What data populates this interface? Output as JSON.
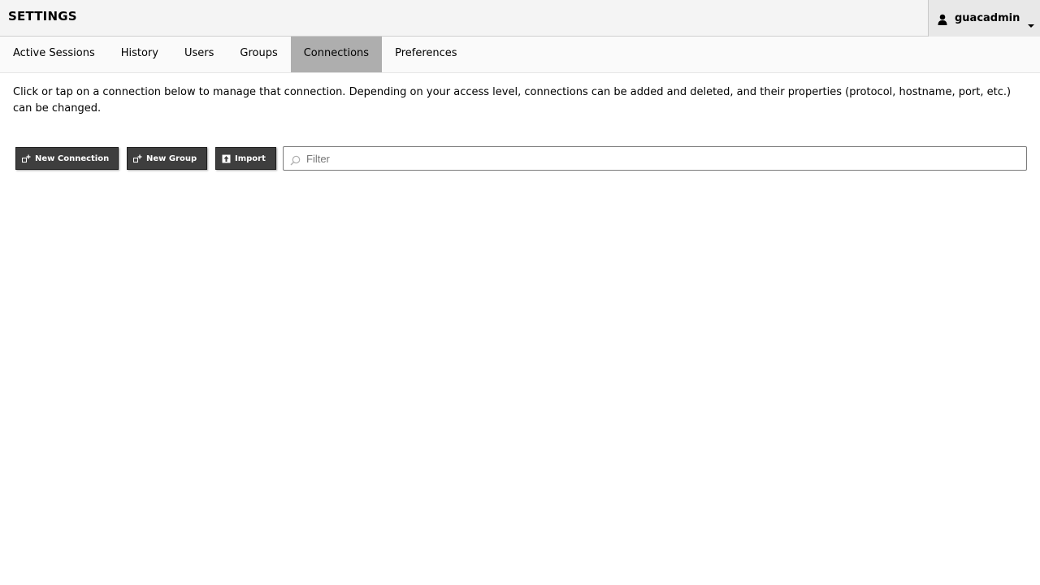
{
  "header": {
    "title": "SETTINGS",
    "user": {
      "username": "guacadmin",
      "icon": "user-icon",
      "dropdown_icon": "caret-down-icon"
    }
  },
  "tabs": [
    {
      "label": "Active Sessions",
      "active": false
    },
    {
      "label": "History",
      "active": false
    },
    {
      "label": "Users",
      "active": false
    },
    {
      "label": "Groups",
      "active": false
    },
    {
      "label": "Connections",
      "active": true
    },
    {
      "label": "Preferences",
      "active": false
    }
  ],
  "main": {
    "description": "Click or tap on a connection below to manage that connection. Depending on your access level, connections can be added and deleted, and their properties (protocol, hostname, port, etc.) can be changed."
  },
  "toolbar": {
    "new_connection_label": "New Connection",
    "new_group_label": "New Group",
    "import_label": "Import",
    "filter": {
      "placeholder": "Filter",
      "value": ""
    }
  },
  "colors": {
    "header_bg": "#f4f4f4",
    "tab_active_bg": "#aeaeae",
    "button_bg": "#3e3e3e",
    "button_text": "#ffffff"
  }
}
